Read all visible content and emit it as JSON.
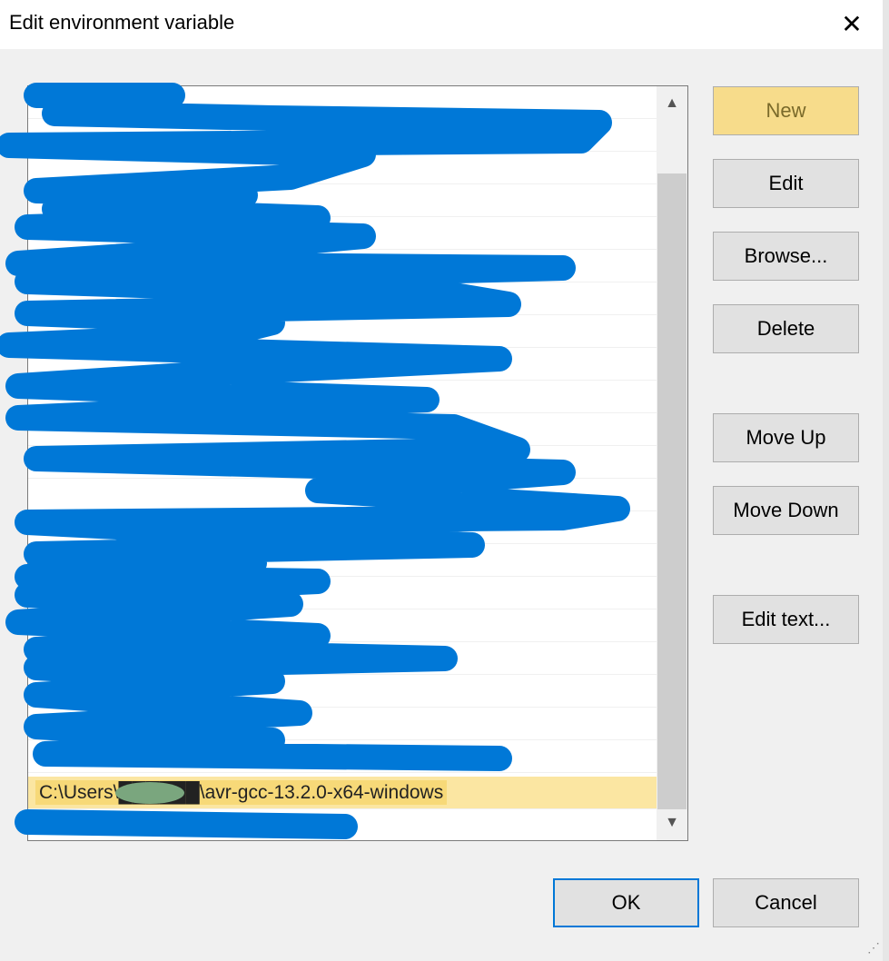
{
  "window": {
    "title": "Edit environment variable",
    "close_glyph": "✕"
  },
  "list": {
    "highlighted_path": "C:\\Users\\██████\\avr-gcc-13.2.0-x64-windows",
    "rows": [
      "",
      "",
      "",
      "",
      "",
      "",
      "",
      "",
      "",
      "",
      "",
      "",
      "",
      "",
      "",
      "",
      "",
      "",
      "",
      "",
      "",
      ""
    ]
  },
  "scrollbar": {
    "up": "▲",
    "down": "▼"
  },
  "buttons": {
    "new": "New",
    "edit": "Edit",
    "browse": "Browse...",
    "delete": "Delete",
    "move_up": "Move Up",
    "move_down": "Move Down",
    "edit_text": "Edit text...",
    "ok": "OK",
    "cancel": "Cancel"
  },
  "colors": {
    "scribble": "#0078d7",
    "highlight": "#f7d978",
    "redact": "#7aa67e"
  }
}
